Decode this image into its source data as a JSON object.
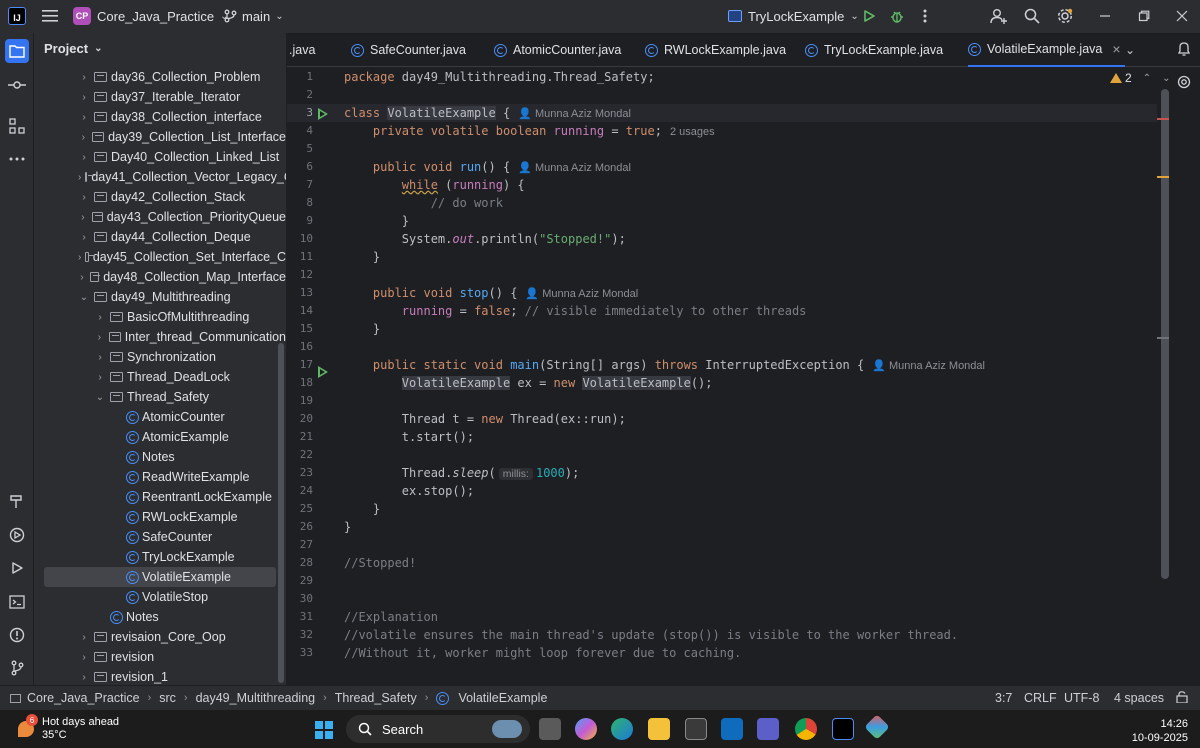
{
  "titlebar": {
    "app_logo": "IJ",
    "project_badge": "CP",
    "project_name": "Core_Java_Practice",
    "branch": "main",
    "run_config": "TryLockExample"
  },
  "project_panel": {
    "title": "Project",
    "tree": [
      {
        "label": "day36_Collection_Problem",
        "type": "folder",
        "indent": 1,
        "expanded": false
      },
      {
        "label": "day37_Iterable_Iterator",
        "type": "folder",
        "indent": 1,
        "expanded": false
      },
      {
        "label": "day38_Collection_interface",
        "type": "folder",
        "indent": 1,
        "expanded": false
      },
      {
        "label": "day39_Collection_List_Interface",
        "type": "folder",
        "indent": 1,
        "expanded": false
      },
      {
        "label": "Day40_Collection_Linked_List",
        "type": "folder",
        "indent": 1,
        "expanded": false
      },
      {
        "label": "day41_Collection_Vector_Legacy_C",
        "type": "folder",
        "indent": 1,
        "expanded": false
      },
      {
        "label": "day42_Collection_Stack",
        "type": "folder",
        "indent": 1,
        "expanded": false
      },
      {
        "label": "day43_Collection_PriorityQueue",
        "type": "folder",
        "indent": 1,
        "expanded": false
      },
      {
        "label": "day44_Collection_Deque",
        "type": "folder",
        "indent": 1,
        "expanded": false
      },
      {
        "label": "day45_Collection_Set_Interface_C",
        "type": "folder",
        "indent": 1,
        "expanded": false
      },
      {
        "label": "day48_Collection_Map_Interface",
        "type": "folder",
        "indent": 1,
        "expanded": false
      },
      {
        "label": "day49_Multithreading",
        "type": "folder",
        "indent": 1,
        "expanded": true
      },
      {
        "label": "BasicOfMultithreading",
        "type": "folder",
        "indent": 2,
        "expanded": false
      },
      {
        "label": "Inter_thread_Communication",
        "type": "folder",
        "indent": 2,
        "expanded": false
      },
      {
        "label": "Synchronization",
        "type": "folder",
        "indent": 2,
        "expanded": false
      },
      {
        "label": "Thread_DeadLock",
        "type": "folder",
        "indent": 2,
        "expanded": false
      },
      {
        "label": "Thread_Safety",
        "type": "folder",
        "indent": 2,
        "expanded": true
      },
      {
        "label": "AtomicCounter",
        "type": "class",
        "indent": 3
      },
      {
        "label": "AtomicExample",
        "type": "class",
        "indent": 3
      },
      {
        "label": "Notes",
        "type": "class",
        "indent": 3
      },
      {
        "label": "ReadWriteExample",
        "type": "class",
        "indent": 3
      },
      {
        "label": "ReentrantLockExample",
        "type": "class",
        "indent": 3
      },
      {
        "label": "RWLockExample",
        "type": "class",
        "indent": 3
      },
      {
        "label": "SafeCounter",
        "type": "class",
        "indent": 3
      },
      {
        "label": "TryLockExample",
        "type": "class",
        "indent": 3
      },
      {
        "label": "VolatileExample",
        "type": "class",
        "indent": 3,
        "selected": true
      },
      {
        "label": "VolatileStop",
        "type": "class",
        "indent": 3
      },
      {
        "label": "Notes",
        "type": "class",
        "indent": 2
      },
      {
        "label": "revisaion_Core_Oop",
        "type": "folder",
        "indent": 1,
        "expanded": false
      },
      {
        "label": "revision",
        "type": "folder",
        "indent": 1,
        "expanded": false
      },
      {
        "label": "revision_1",
        "type": "folder",
        "indent": 1,
        "expanded": false
      }
    ]
  },
  "tabs": [
    {
      "label": ".java",
      "icon": false
    },
    {
      "label": "SafeCounter.java",
      "icon": true
    },
    {
      "label": "AtomicCounter.java",
      "icon": true
    },
    {
      "label": "RWLockExample.java",
      "icon": true
    },
    {
      "label": "TryLockExample.java",
      "icon": true
    },
    {
      "label": "VolatileExample.java",
      "icon": true,
      "active": true
    }
  ],
  "editor": {
    "warning_count": "2",
    "line_numbers": [
      "1",
      "2",
      "3",
      "4",
      "5",
      "6",
      "7",
      "8",
      "9",
      "10",
      "11",
      "12",
      "13",
      "14",
      "15",
      "16",
      "17",
      "18",
      "19",
      "20",
      "21",
      "22",
      "23",
      "24",
      "25",
      "26",
      "27",
      "28",
      "29",
      "30",
      "31",
      "32",
      "33"
    ],
    "inlay": {
      "author": "Munna Aziz Mondal",
      "usages": "2 usages",
      "millis": "millis:"
    },
    "code": {
      "l1_pkg": "package",
      "l1_rest": " day49_Multithreading.Thread_Safety;",
      "l3_class": "class",
      "l3_name": "VolatileExample",
      "l3_brace": " {",
      "l4_mods": "    private volatile boolean",
      "l4_field": "running",
      "l4_eq": " = ",
      "l4_true": "true",
      "l4_semi": ";",
      "l6_mods": "    public void",
      "l6_fn": "run",
      "l6_rest": "() {",
      "l7_while": "while",
      "l7_open": " (",
      "l7_field": "running",
      "l7_close": ") {",
      "l8_cm": "// do work",
      "l9": "        }",
      "l10_pre": "        System.",
      "l10_out": "out",
      "l10_mid": ".println(",
      "l10_str": "\"Stopped!\"",
      "l10_end": ");",
      "l11": "    }",
      "l13_mods": "    public void",
      "l13_fn": "stop",
      "l13_rest": "() {",
      "l14_field": "running",
      "l14_eq": " = ",
      "l14_false": "false",
      "l14_semi": "; ",
      "l14_cm": "// visible immediately to other threads",
      "l15": "    }",
      "l17_mods": "    public static void",
      "l17_fn": "main",
      "l17_args": "(String[] args) ",
      "l17_throws": "throws",
      "l17_exc": " InterruptedException {",
      "l18_type": "VolatileExample",
      "l18_mid": " ex = ",
      "l18_new": "new",
      "l18_type2": "VolatileExample",
      "l18_end": "();",
      "l20_pre": "        Thread t = ",
      "l20_new": "new",
      "l20_rest": " Thread(ex::run);",
      "l21": "        t.start();",
      "l23_pre": "        Thread.",
      "l23_sleep": "sleep",
      "l23_open": "(",
      "l23_num": "1000",
      "l23_end": ");",
      "l24": "        ex.stop();",
      "l25": "    }",
      "l26": "}",
      "l28_cm": "//Stopped!",
      "l31_cm": "//Explanation",
      "l32_cm": "//volatile ensures the main thread's update (stop()) is visible to the worker thread.",
      "l33_cm": "//Without it, worker might loop forever due to caching."
    }
  },
  "statusbar": {
    "breadcrumbs": [
      "Core_Java_Practice",
      "src",
      "day49_Multithreading",
      "Thread_Safety",
      "VolatileExample"
    ],
    "position": "3:7",
    "line_sep": "CRLF",
    "encoding": "UTF-8",
    "indent": "4 spaces"
  },
  "taskbar": {
    "weather_title": "Hot days ahead",
    "weather_temp": "35°C",
    "weather_badge": "6",
    "search_placeholder": "Search",
    "time": "14:26",
    "date": "10-09-2025"
  },
  "colors": {
    "accent": "#3574f0",
    "keyword": "#cf8e6d",
    "function": "#56a8f5",
    "field": "#c77dbb",
    "string": "#6aab73",
    "number": "#2aacb8",
    "comment": "#7a7e85",
    "run_green": "#5fb865",
    "warning": "#e0a43a"
  }
}
